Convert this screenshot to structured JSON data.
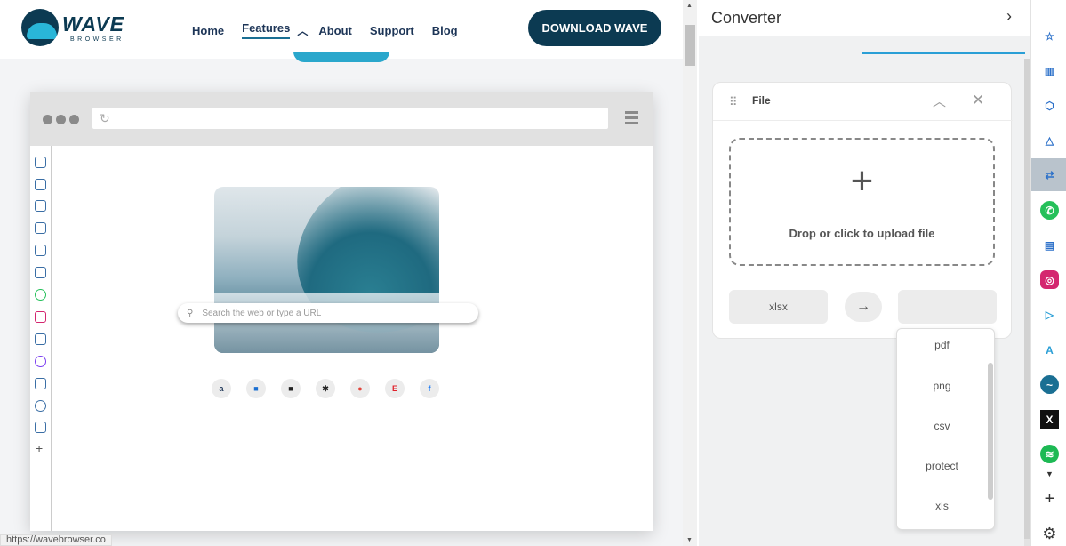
{
  "site": {
    "brand": "WAVE",
    "brand_sub": "BROWSER",
    "nav": [
      "Home",
      "Features",
      "About",
      "Support",
      "Blog"
    ],
    "download_label": "DOWNLOAD WAVE",
    "mock_search_placeholder": "Search the web or type a URL",
    "status_url": "https://wavebrowser.co"
  },
  "converter": {
    "title": "Converter",
    "card_title": "File",
    "drop_text": "Drop or click to upload file",
    "from_format": "xlsx",
    "to_format": "",
    "options": [
      "pdf",
      "png",
      "csv",
      "protect",
      "xls"
    ]
  },
  "icons": {
    "panel_collapse": "chevron-right-icon",
    "swap": "arrow-right-icon",
    "rail": [
      "bookmark-star-icon",
      "reading-list-icon",
      "box-icon",
      "tent-icon",
      "converter-icon",
      "whatsapp-icon",
      "notes-icon",
      "instagram-icon",
      "video-icon",
      "translate-icon",
      "wave-icon",
      "x-icon",
      "spotify-icon",
      "add-icon",
      "settings-icon"
    ]
  },
  "colors": {
    "brand_dark": "#0c3a52",
    "accent": "#2a9fd6",
    "active_rail": "#b9c3cc"
  }
}
